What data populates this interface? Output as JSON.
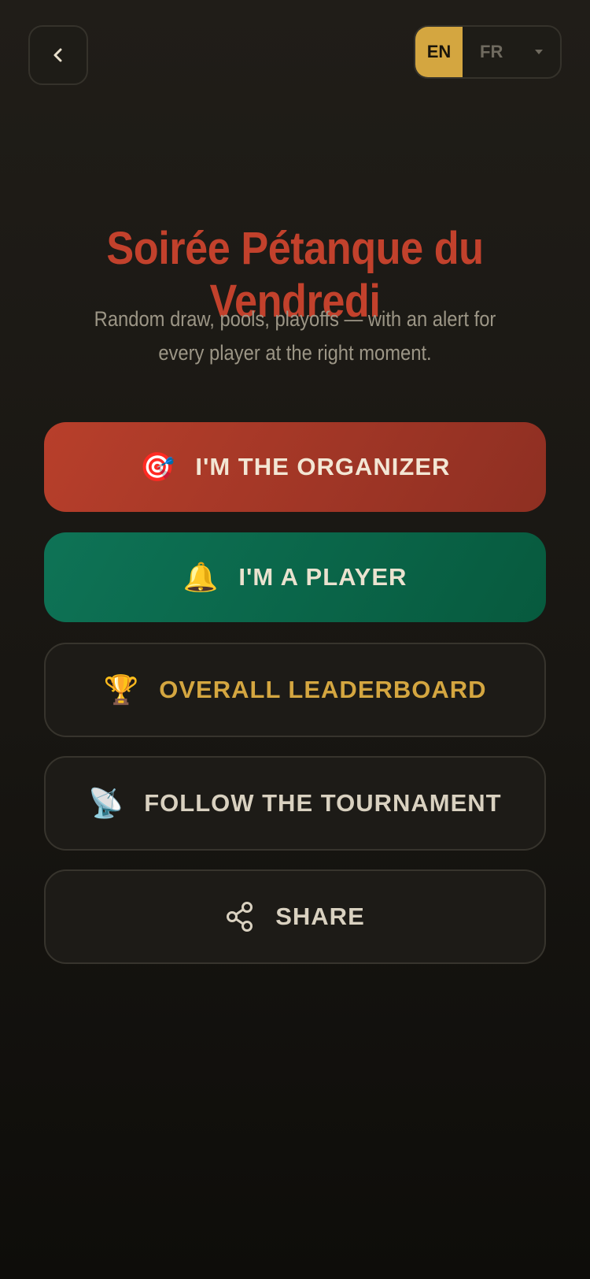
{
  "header": {
    "back_label": "‹",
    "lang_active": "EN",
    "lang_other": "FR"
  },
  "hero": {
    "title": "Soirée Pétanque du Vendredi",
    "subtitle": "Random draw, pools, playoffs — with an alert for every player at the right moment."
  },
  "actions": {
    "organizer": {
      "icon": "🎯",
      "label": "I'M THE ORGANIZER"
    },
    "player": {
      "icon": "🔔",
      "label": "I'M A PLAYER"
    },
    "leaderboard": {
      "icon": "🏆",
      "label": "OVERALL LEADERBOARD"
    },
    "follow": {
      "icon": "📡",
      "label": "FOLLOW THE TOURNAMENT"
    },
    "share": {
      "icon": "share-icon",
      "label": "SHARE"
    }
  },
  "colors": {
    "accent_gold": "#d4a640",
    "organizer_red": "#b83f2b",
    "player_green": "#0e7356",
    "title_red": "#c2412c"
  }
}
